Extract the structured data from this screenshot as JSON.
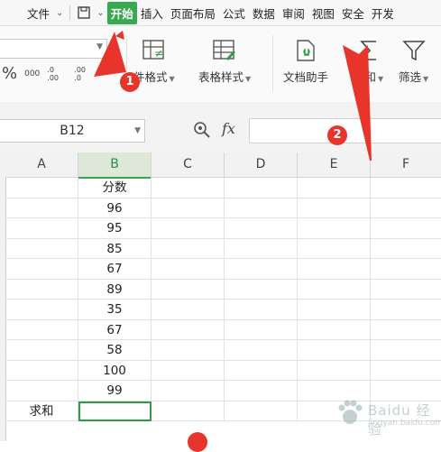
{
  "menubar": {
    "items": [
      "文件",
      "开始",
      "插入",
      "页面布局",
      "公式",
      "数据",
      "审阅",
      "视图",
      "安全",
      "开发"
    ],
    "active_tab": "开始",
    "file_dropdown": "⌄",
    "quick_dropdown": "⌄"
  },
  "ribbon": {
    "percent_symbol": "%",
    "thousands_symbol": "000",
    "increase_decimal": ".0 .00",
    "decrease_decimal": ".00 .0",
    "buttons": {
      "conditional_format": "件格式",
      "table_style": "表格样式",
      "doc_assistant": "文档助手",
      "sum": "求和",
      "filter": "筛选"
    }
  },
  "formula_bar": {
    "name_box": "B12",
    "fx_label": "fx",
    "formula_value": ""
  },
  "sheet": {
    "columns": [
      "A",
      "B",
      "C",
      "D",
      "E",
      "F"
    ],
    "active_column": "B",
    "rows": [
      {
        "a": "",
        "b": "分数"
      },
      {
        "a": "",
        "b": "96"
      },
      {
        "a": "",
        "b": "95"
      },
      {
        "a": "",
        "b": "85"
      },
      {
        "a": "",
        "b": "67"
      },
      {
        "a": "",
        "b": "89"
      },
      {
        "a": "",
        "b": "35"
      },
      {
        "a": "",
        "b": "67"
      },
      {
        "a": "",
        "b": "58"
      },
      {
        "a": "",
        "b": "100"
      },
      {
        "a": "",
        "b": "99"
      },
      {
        "a": "求和",
        "b": ""
      }
    ]
  },
  "annotations": {
    "badge_1": "1",
    "badge_2": "2",
    "arrow_color": "#e8352b"
  },
  "colors": {
    "accent_green": "#39a852",
    "selection_green": "#2e9b48",
    "annotation_red": "#e8352b"
  },
  "watermark": {
    "text": "Baidu 经验",
    "sub": "jingyan.baidu.com"
  }
}
